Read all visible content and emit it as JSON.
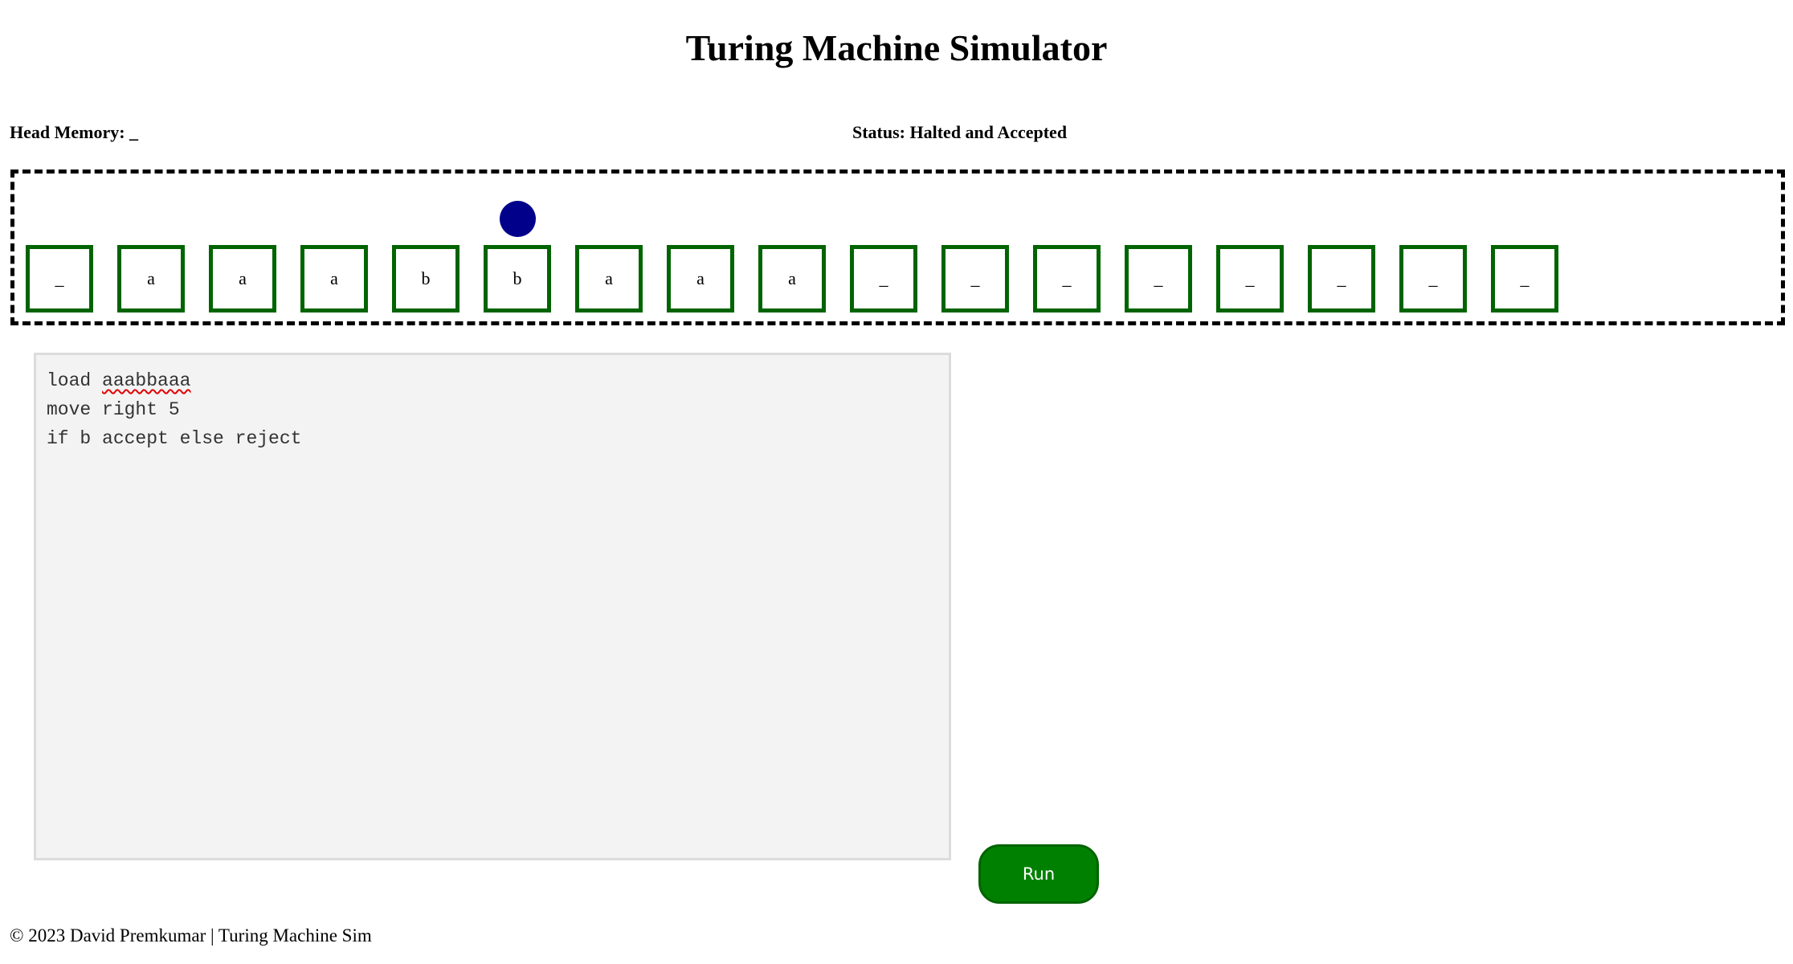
{
  "header": {
    "title": "Turing Machine Simulator"
  },
  "head_memory": {
    "label": "Head Memory: _"
  },
  "status": {
    "label": "Status: Halted and Accepted"
  },
  "tape": {
    "cells": [
      "_",
      "a",
      "a",
      "a",
      "b",
      "b",
      "a",
      "a",
      "a",
      "_",
      "_",
      "_",
      "_",
      "_",
      "_",
      "_",
      "_"
    ],
    "head_index": 5
  },
  "editor": {
    "lines": [
      [
        "load ",
        "aaabbaaa"
      ],
      [
        "move right 5"
      ],
      [
        "if b accept else reject"
      ]
    ]
  },
  "run_button": {
    "label": "Run"
  },
  "footer": {
    "text": "© 2023 David Premkumar | Turing Machine Sim"
  },
  "colors": {
    "cell_border": "#006400",
    "head": "#00008b",
    "run_button": "#008000",
    "editor_bg": "#f3f3f3"
  }
}
